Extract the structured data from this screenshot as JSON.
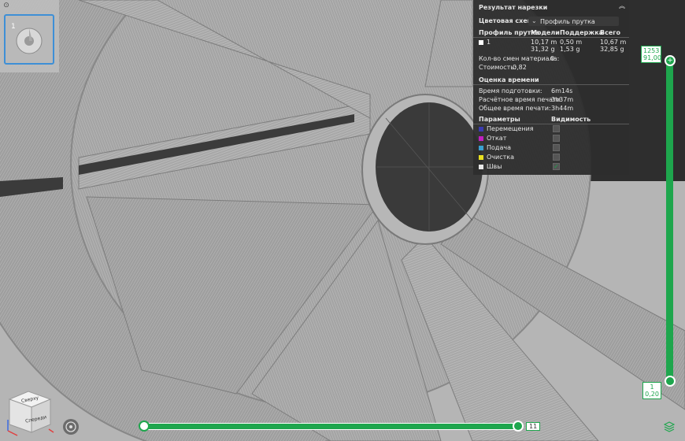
{
  "plate": {
    "number": "1"
  },
  "slice_panel": {
    "title": "Результат нарезки",
    "color_scheme_label": "Цветовая схема",
    "color_scheme_value": "Профиль прутка",
    "headers": {
      "filament_profile": "Профиль прутка",
      "models": "Модели",
      "support": "Поддержка",
      "total": "Всего"
    },
    "filament_row": {
      "name": "1",
      "models_length": "10,17 m",
      "models_weight": "31,32 g",
      "support_length": "0,50 m",
      "support_weight": "1,53 g",
      "total_length": "10,67 m",
      "total_weight": "32,85 g"
    },
    "material_changes_label": "Кол-во смен материала:",
    "material_changes_value": "0",
    "cost_label": "Стоимость:",
    "cost_value": "0,82",
    "time_estimate_title": "Оценка времени",
    "prep_time_label": "Время подготовки:",
    "prep_time_value": "6m14s",
    "print_time_label": "Расчётное время печати:",
    "print_time_value": "3h37m",
    "total_time_label": "Общее время печати:",
    "total_time_value": "3h44m",
    "params_header": "Параметры",
    "visibility_header": "Видимость",
    "params": [
      {
        "label": "Перемещения",
        "color": "#3b3bb0",
        "visible": false
      },
      {
        "label": "Откат",
        "color": "#c020c0",
        "visible": false
      },
      {
        "label": "Подача",
        "color": "#3aa0d0",
        "visible": false
      },
      {
        "label": "Очистка",
        "color": "#e8e020",
        "visible": false
      },
      {
        "label": "Швы",
        "color": "#e8e8e8",
        "visible": true
      }
    ]
  },
  "layer_slider": {
    "top_layer": "1253",
    "top_height": "91,00",
    "bottom_layer": "1",
    "bottom_height": "0,20"
  },
  "move_slider": {
    "value": "11"
  },
  "view_cube": {
    "top_label": "Сверху",
    "front_label": "Спереди"
  },
  "colors": {
    "accent": "#1ea64d",
    "selection": "#3e8fd6"
  }
}
